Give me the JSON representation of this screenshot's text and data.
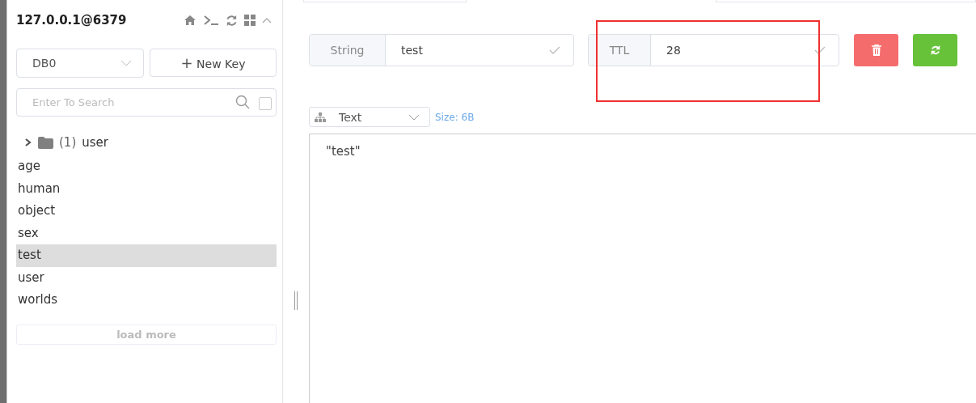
{
  "sidebar": {
    "connection": "127.0.0.1@6379",
    "db_select": {
      "value": "DB0"
    },
    "new_key_button": {
      "icon": "+",
      "label": "New Key"
    },
    "search": {
      "placeholder": "Enter To Search",
      "exact_match": false
    },
    "folders": [
      {
        "count": "(1)",
        "label": "user",
        "expanded": false
      }
    ],
    "keys": [
      {
        "label": "age",
        "selected": false
      },
      {
        "label": "human",
        "selected": false
      },
      {
        "label": "object",
        "selected": false
      },
      {
        "label": "sex",
        "selected": false
      },
      {
        "label": "test",
        "selected": true
      },
      {
        "label": "user",
        "selected": false
      },
      {
        "label": "worlds",
        "selected": false
      }
    ],
    "load_more": "load more"
  },
  "key_detail": {
    "type": "String",
    "key_name": "test",
    "ttl_label": "TTL",
    "ttl": "28",
    "view_format": "Text",
    "size": "Size: 6B",
    "value": "\"test\""
  }
}
